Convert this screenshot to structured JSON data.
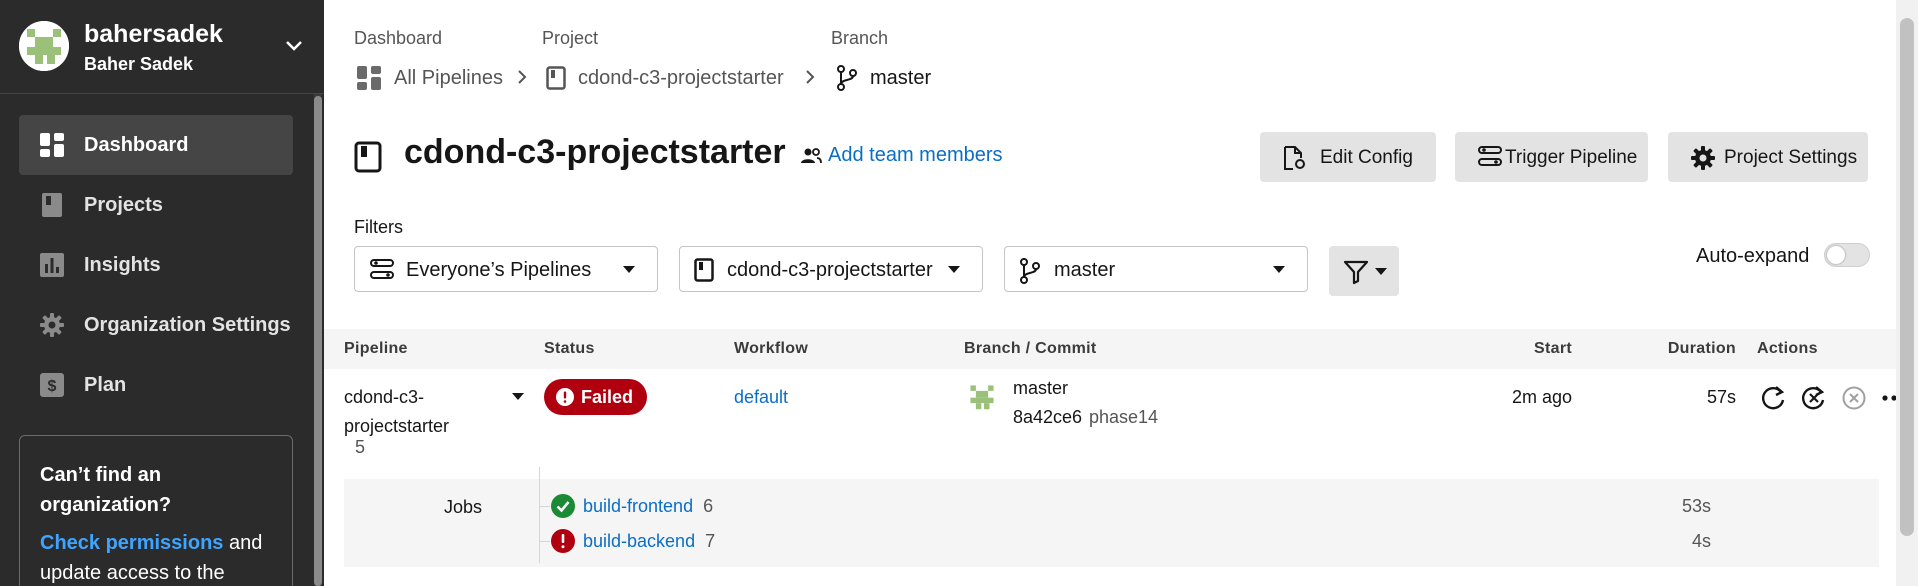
{
  "sidebar": {
    "org_login": "bahersadek",
    "org_name": "Baher Sadek",
    "items": [
      {
        "label": "Dashboard",
        "icon": "dashboard-icon",
        "active": true
      },
      {
        "label": "Projects",
        "icon": "projects-icon"
      },
      {
        "label": "Insights",
        "icon": "insights-icon"
      },
      {
        "label": "Organization Settings",
        "icon": "gear-icon"
      },
      {
        "label": "Plan",
        "icon": "plan-icon"
      }
    ],
    "help_card": {
      "title": "Can’t find an organization?",
      "link": "Check permissions",
      "text_after": " and update access to the"
    }
  },
  "breadcrumb": {
    "labels": [
      "Dashboard",
      "Project",
      "Branch"
    ],
    "items": [
      "All Pipelines",
      "cdond-c3-projectstarter",
      "master"
    ]
  },
  "header": {
    "title": "cdond-c3-projectstarter",
    "add_team": "Add team members",
    "buttons": {
      "edit_config": "Edit Config",
      "trigger_pipeline": "Trigger Pipeline",
      "project_settings": "Project Settings"
    }
  },
  "filters": {
    "label": "Filters",
    "pipelines": "Everyone’s Pipelines",
    "project": "cdond-c3-projectstarter",
    "branch": "master",
    "auto_expand": "Auto-expand",
    "auto_expand_on": false
  },
  "table": {
    "columns": {
      "pipeline": "Pipeline",
      "status": "Status",
      "workflow": "Workflow",
      "branch_commit": "Branch / Commit",
      "start": "Start",
      "duration": "Duration",
      "actions": "Actions"
    },
    "row": {
      "pipeline": "cdond-c3-projectstarter",
      "number": "5",
      "status": "Failed",
      "workflow": "default",
      "branch": "master",
      "commit_hash": "8a42ce6",
      "commit_message": "phase14",
      "start": "2m ago",
      "duration": "57s"
    },
    "jobs_label": "Jobs",
    "jobs": [
      {
        "name": "build-frontend",
        "number": "6",
        "status": "success",
        "duration": "53s"
      },
      {
        "name": "build-backend",
        "number": "7",
        "status": "failed",
        "duration": "4s"
      }
    ]
  },
  "colors": {
    "sidebar_bg": "#2b2b2b",
    "link": "#0a6ec7",
    "failed": "#b00010",
    "success": "#1a8a34",
    "button_bg": "#e3e3e3"
  }
}
